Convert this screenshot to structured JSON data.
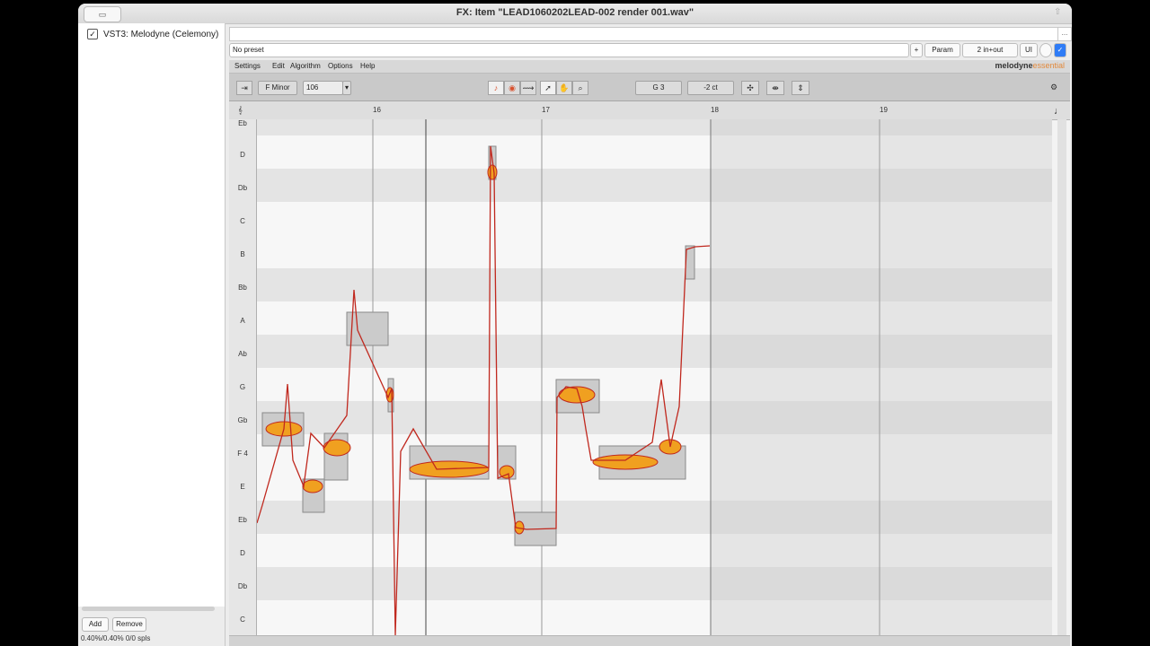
{
  "window": {
    "title": "FX: Item \"LEAD1060202LEAD-002 render 001.wav\"",
    "titlebar_button_icon": "window-icon"
  },
  "fx_list": {
    "items": [
      {
        "label": "VST3: Melodyne (Celemony)",
        "checked": "✓"
      }
    ]
  },
  "left_buttons": {
    "add": "Add",
    "remove": "Remove",
    "cpu": "0.40%/0.40% 0/0 spls"
  },
  "top_row": {
    "more_button": "..."
  },
  "preset_row": {
    "preset": "No preset",
    "plus": "+",
    "param": "Param",
    "io": "2 in+out",
    "ui": "UI"
  },
  "menu": {
    "items": [
      "Settings",
      "Edit",
      "Algorithm",
      "Options",
      "Help"
    ],
    "logo_main": "melodyne",
    "logo_sub": "essential"
  },
  "toolbar": {
    "scale": "F Minor",
    "tempo": "106",
    "note": "G 3",
    "cents": "-2 ct"
  },
  "ruler": {
    "bars": [
      "16",
      "17",
      "18",
      "19"
    ]
  },
  "keys": [
    "Eb",
    "D",
    "Db",
    "C",
    "B",
    "Bb",
    "A",
    "Ab",
    "G",
    "Gb",
    "F 4",
    "E",
    "Eb",
    "D",
    "Db",
    "C"
  ],
  "colors": {
    "blob_fill": "#f0a020",
    "pitch_line": "#c0281e",
    "note_box": "#c8c8c8"
  }
}
